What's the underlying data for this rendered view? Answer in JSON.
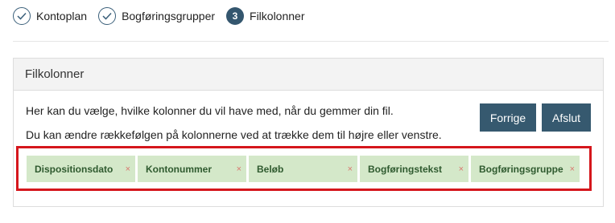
{
  "stepper": {
    "steps": [
      {
        "label": "Kontoplan",
        "state": "done"
      },
      {
        "label": "Bogføringsgrupper",
        "state": "done"
      },
      {
        "label": "Filkolonner",
        "state": "current",
        "number": "3"
      }
    ]
  },
  "panel": {
    "title": "Filkolonner",
    "description_1": "Her kan du vælge, hvilke kolonner du vil have med, når du gemmer din fil.",
    "description_2": "Du kan ændre rækkefølgen på kolonnerne ved at trække dem til højre eller venstre.",
    "buttons": {
      "prev_label": "Forrige",
      "finish_label": "Afslut"
    },
    "columns": [
      {
        "label": "Dispositionsdato",
        "remove": "×"
      },
      {
        "label": "Kontonummer",
        "remove": "×"
      },
      {
        "label": "Beløb",
        "remove": "×"
      },
      {
        "label": "Bogføringstekst",
        "remove": "×"
      },
      {
        "label": "Bogføringsgruppe",
        "remove": "×"
      }
    ]
  },
  "colors": {
    "accent": "#36596f",
    "chip_bg": "#d4e8c9",
    "chip_text": "#2f5a2f",
    "highlight": "#d5161c"
  }
}
